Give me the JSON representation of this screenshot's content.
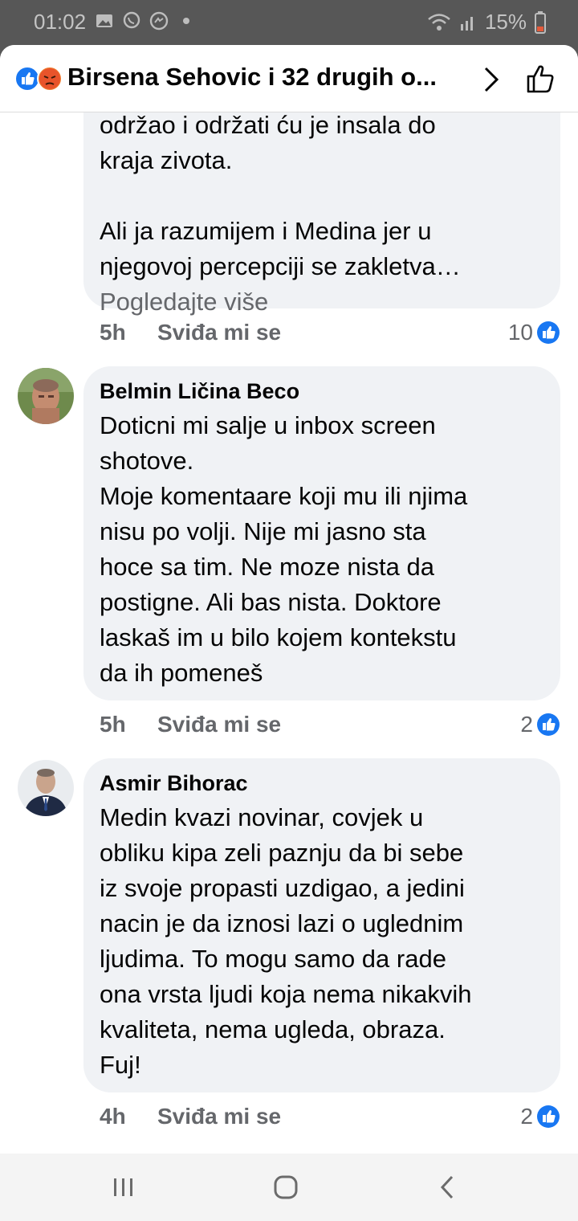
{
  "status_bar": {
    "time": "01:02",
    "battery": "15%",
    "icons": [
      "image-icon",
      "viber-icon",
      "messenger-icon",
      "dot-icon",
      "wifi-icon",
      "signal-icon",
      "battery-icon"
    ]
  },
  "header": {
    "title": "Birsena Sehovic i 32 drugih o...",
    "reaction_icons": [
      "like-icon",
      "angry-icon"
    ]
  },
  "comments": [
    {
      "name": "",
      "text_partial_top": "održao i održati ću je insala do",
      "text": "kraja zivota.\n\nAli ja razumijem i Medina jer u\nnjegovoj percepciji se zakletva…",
      "see_more": "Pogledajte više",
      "time": "5h",
      "like_label": "Sviđa mi se",
      "like_count": "10"
    },
    {
      "name": "Belmin Ličina Beco",
      "text": "Doticni mi salje u inbox screen\nshotove.\nMoje komentaare koji mu ili njima\nnisu po volji. Nije mi jasno sta\nhoce sa tim. Ne moze nista da\npostigne. Ali bas nista. Doktore\nlaskaš im u bilo kojem kontekstu\nda ih pomeneš",
      "time": "5h",
      "like_label": "Sviđa mi se",
      "like_count": "2"
    },
    {
      "name": "Asmir Bihorac",
      "text": "Medin kvazi novinar, covjek u\nobliku kipa zeli paznju da bi sebe\niz svoje propasti uzdigao, a jedini\nnacin je da iznosi lazi o uglednim\nljudima. To mogu samo da rade\nona vrsta ljudi koja nema nikakvih\nkvaliteta, nema ugleda, obraza.\nFuj!",
      "time": "4h",
      "like_label": "Sviđa mi se",
      "like_count": "2"
    }
  ],
  "colors": {
    "like_blue": "#1877f2",
    "bubble_bg": "#f0f2f5",
    "secondary_text": "#65676b"
  }
}
